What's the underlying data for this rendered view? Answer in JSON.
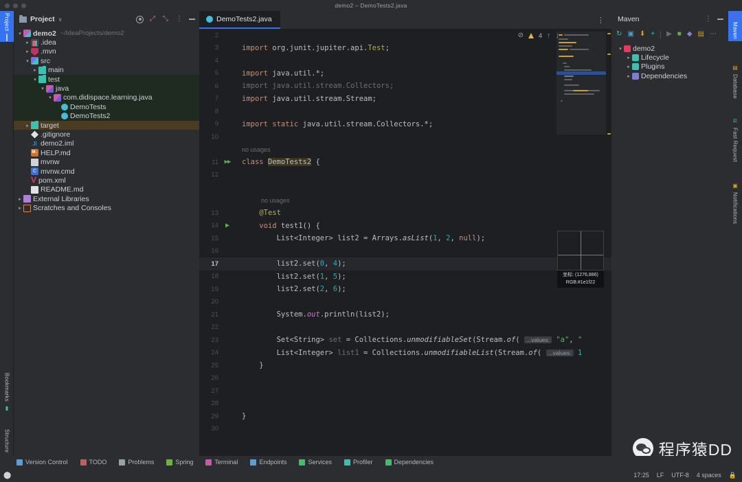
{
  "window": {
    "title": "demo2 – DemoTests2.java"
  },
  "left_tool_tabs": [
    {
      "label": "Project",
      "active": true
    },
    {
      "label": "Bookmarks",
      "active": false
    },
    {
      "label": "Structure",
      "active": false
    }
  ],
  "project_panel": {
    "title": "Project",
    "chevron": "∨",
    "actions": [
      "settings-icon",
      "expand-icon",
      "collapse-icon",
      "more-icon",
      "hide-icon"
    ],
    "tree": [
      {
        "indent": 0,
        "arrow": "open",
        "icon": "module",
        "label": "demo2",
        "bold": true,
        "path": "~/IdeaProjects/demo2"
      },
      {
        "indent": 1,
        "arrow": "closed",
        "icon": "idea",
        "label": ".idea"
      },
      {
        "indent": 1,
        "arrow": "closed",
        "icon": "mvn",
        "label": ".mvn"
      },
      {
        "indent": 1,
        "arrow": "open",
        "icon": "src",
        "label": "src"
      },
      {
        "indent": 2,
        "arrow": "closed",
        "icon": "folder",
        "label": "main"
      },
      {
        "indent": 2,
        "arrow": "open",
        "icon": "folder",
        "label": "test",
        "highlight": "green"
      },
      {
        "indent": 3,
        "arrow": "open",
        "icon": "pkg",
        "label": "java",
        "highlight": "green"
      },
      {
        "indent": 4,
        "arrow": "open",
        "icon": "pkg",
        "label": "com.didispace.learning.java",
        "highlight": "green"
      },
      {
        "indent": 5,
        "arrow": "none",
        "icon": "class",
        "label": "DemoTests",
        "highlight": "green"
      },
      {
        "indent": 5,
        "arrow": "none",
        "icon": "class",
        "label": "DemoTests2",
        "highlight": "green"
      },
      {
        "indent": 1,
        "arrow": "closed",
        "icon": "folder",
        "label": "target",
        "highlight": "brown"
      },
      {
        "indent": 1,
        "arrow": "none",
        "icon": "git",
        "label": ".gitignore"
      },
      {
        "indent": 1,
        "arrow": "none",
        "icon": "iml",
        "label": "demo2.iml"
      },
      {
        "indent": 1,
        "arrow": "none",
        "icon": "md",
        "label": "HELP.md"
      },
      {
        "indent": 1,
        "arrow": "none",
        "icon": "file",
        "label": "mvnw"
      },
      {
        "indent": 1,
        "arrow": "none",
        "icon": "cmd",
        "label": "mvnw.cmd"
      },
      {
        "indent": 1,
        "arrow": "none",
        "icon": "pom",
        "label": "pom.xml"
      },
      {
        "indent": 1,
        "arrow": "none",
        "icon": "readme",
        "label": "README.md"
      },
      {
        "indent": 0,
        "arrow": "closed",
        "icon": "lib",
        "label": "External Libraries"
      },
      {
        "indent": 0,
        "arrow": "closed",
        "icon": "scr",
        "label": "Scratches and Consoles"
      }
    ]
  },
  "editor": {
    "tab": {
      "label": "DemoTests2.java",
      "icon": "java-class-icon"
    },
    "tabbar_more": "⋮",
    "inspections": {
      "warning_count": "4",
      "eye_icon": "inspection-off-icon",
      "up_arrow": "↑",
      "down_arrow": "↓"
    },
    "current_line": 17,
    "lines": [
      {
        "n": 2,
        "text": ""
      },
      {
        "n": 3,
        "html": "<span class='kw'>import</span> org.junit.jupiter.api.<span class='anno'>Test</span>;"
      },
      {
        "n": 4,
        "text": ""
      },
      {
        "n": 5,
        "html": "<span class='kw'>import</span> java.util.*;"
      },
      {
        "n": 6,
        "html": "<span class='gray'>import java.util.stream.Collectors;</span>"
      },
      {
        "n": 7,
        "html": "<span class='kw'>import</span> java.util.stream.Stream;"
      },
      {
        "n": 8,
        "text": ""
      },
      {
        "n": 9,
        "html": "<span class='kw'>import static</span> java.util.stream.Collectors.*;"
      },
      {
        "n": 10,
        "text": ""
      },
      {
        "n": "",
        "hint": "no usages"
      },
      {
        "n": 11,
        "gutter": "run-dbl",
        "html": "<span class='kw'>class</span> <span class='cls-hl'>DemoTests2</span> {"
      },
      {
        "n": 12,
        "text": ""
      },
      {
        "n": "",
        "text": ""
      },
      {
        "n": "",
        "hint": "no usages",
        "indent": 1
      },
      {
        "n": 13,
        "html": "    <span class='anno'>@Test</span>"
      },
      {
        "n": 14,
        "gutter": "run-tri",
        "html": "    <span class='kw'>void</span> test1() {"
      },
      {
        "n": 15,
        "html": "        List&lt;Integer&gt; list2 = Arrays.<span class='mth'>asList</span>(<span class='num'>1</span>, <span class='num'>2</span>, <span class='kw'>null</span>);"
      },
      {
        "n": 16,
        "text": ""
      },
      {
        "n": 17,
        "current": true,
        "html": "        list2.set(<span class='num'>0</span>, <span class='num'>4</span>);"
      },
      {
        "n": 18,
        "html": "        list2.set(<span class='num'>1</span>, <span class='num'>5</span>);"
      },
      {
        "n": 19,
        "html": "        list2.set(<span class='num'>2</span>, <span class='num'>6</span>);"
      },
      {
        "n": 20,
        "text": ""
      },
      {
        "n": 21,
        "html": "        System.<span class='fld'>out</span>.println(list2);"
      },
      {
        "n": 22,
        "text": ""
      },
      {
        "n": 23,
        "html": "        Set&lt;String&gt; <span class='gray'>set</span> = Collections.<span class='mth'>unmodifiableSet</span>(Stream.<span class='mth'>of</span>( <span class='param-hint'>...values:</span> <span class='str'>\"a\"</span>, <span class='str'>\"</span>"
      },
      {
        "n": 24,
        "html": "        List&lt;Integer&gt; <span class='gray'>list1</span> = Collections.<span class='mth'>unmodifiableList</span>(Stream.<span class='mth'>of</span>( <span class='param-hint'>...values:</span> <span class='num'>1</span>"
      },
      {
        "n": 25,
        "html": "    }"
      },
      {
        "n": 26,
        "text": ""
      },
      {
        "n": 27,
        "text": ""
      },
      {
        "n": 28,
        "text": ""
      },
      {
        "n": 29,
        "html": "}"
      },
      {
        "n": 30,
        "text": ""
      }
    ]
  },
  "magnifier_tooltip": {
    "coord_label": "坐标:",
    "coord_value": "(1276,886)",
    "rgb_label": "RGB:",
    "rgb_value": "#1e1f22"
  },
  "maven_panel": {
    "title": "Maven",
    "actions": [
      "more-icon",
      "hide-icon"
    ],
    "toolbar": [
      {
        "name": "reload-icon",
        "glyph": "↻",
        "color": "#3fbfb0"
      },
      {
        "name": "add-maven-project-icon",
        "glyph": "▣",
        "color": "#4a9ad4"
      },
      {
        "name": "download-sources-icon",
        "glyph": "⬇",
        "color": "#d4a017"
      },
      {
        "name": "add-icon",
        "glyph": "+",
        "color": "#3fbfb0"
      },
      {
        "name": "run-icon",
        "glyph": "▶",
        "color": "#6a6e73"
      },
      {
        "name": "execute-goal-icon",
        "glyph": "■",
        "color": "#5fad4e"
      },
      {
        "name": "toggle-skip-tests-icon",
        "glyph": "◆",
        "color": "#8a7fd4"
      },
      {
        "name": "show-settings-icon",
        "glyph": "▤",
        "color": "#d4a017"
      },
      {
        "name": "more-options-icon",
        "glyph": "⋯",
        "color": "#9ba0a6"
      }
    ],
    "tree": [
      {
        "indent": 0,
        "arrow": "open",
        "icon": "maven-project",
        "label": "demo2"
      },
      {
        "indent": 1,
        "arrow": "closed",
        "icon": "lifecycle",
        "label": "Lifecycle"
      },
      {
        "indent": 1,
        "arrow": "closed",
        "icon": "plugins",
        "label": "Plugins"
      },
      {
        "indent": 1,
        "arrow": "closed",
        "icon": "dependencies",
        "label": "Dependencies"
      }
    ]
  },
  "right_tool_tabs": [
    {
      "label": "Maven",
      "active": true,
      "icon_color": "#e5395e"
    },
    {
      "label": "Database",
      "active": false,
      "icon_color": "#d4a017"
    },
    {
      "label": "Fast Request",
      "active": false,
      "icon_color": "#3fbf6a"
    },
    {
      "label": "Notifications",
      "active": false,
      "icon_color": "#d4a017"
    }
  ],
  "status_bar": {
    "items": [
      {
        "label": "Version Control",
        "icon_color": "#5a9fd4"
      },
      {
        "label": "TODO",
        "icon_color": "#c75a5a"
      },
      {
        "label": "Problems",
        "icon_color": "#8fa3b0"
      },
      {
        "label": "Spring",
        "icon_color": "#6db33f"
      },
      {
        "label": "Terminal",
        "icon_color": "#c75ab0"
      },
      {
        "label": "Endpoints",
        "icon_color": "#5a9fd4"
      },
      {
        "label": "Services",
        "icon_color": "#3fbf6a"
      },
      {
        "label": "Profiler",
        "icon_color": "#3fbfb0"
      },
      {
        "label": "Dependencies",
        "icon_color": "#3fbf6a"
      }
    ],
    "right": {
      "position": "17:25",
      "line_separator": "LF",
      "encoding": "UTF-8",
      "indent": "4 spaces",
      "lock": "lock-icon"
    }
  },
  "watermark": {
    "text": "程序猿DD",
    "icon": "wechat-icon"
  },
  "colors": {
    "bg": "#1e1f22",
    "panel": "#2b2d30",
    "accent": "#3573f0",
    "keyword": "#cf8e6d",
    "string": "#6aab73",
    "number": "#2aacb8",
    "annotation": "#b3ae60"
  }
}
